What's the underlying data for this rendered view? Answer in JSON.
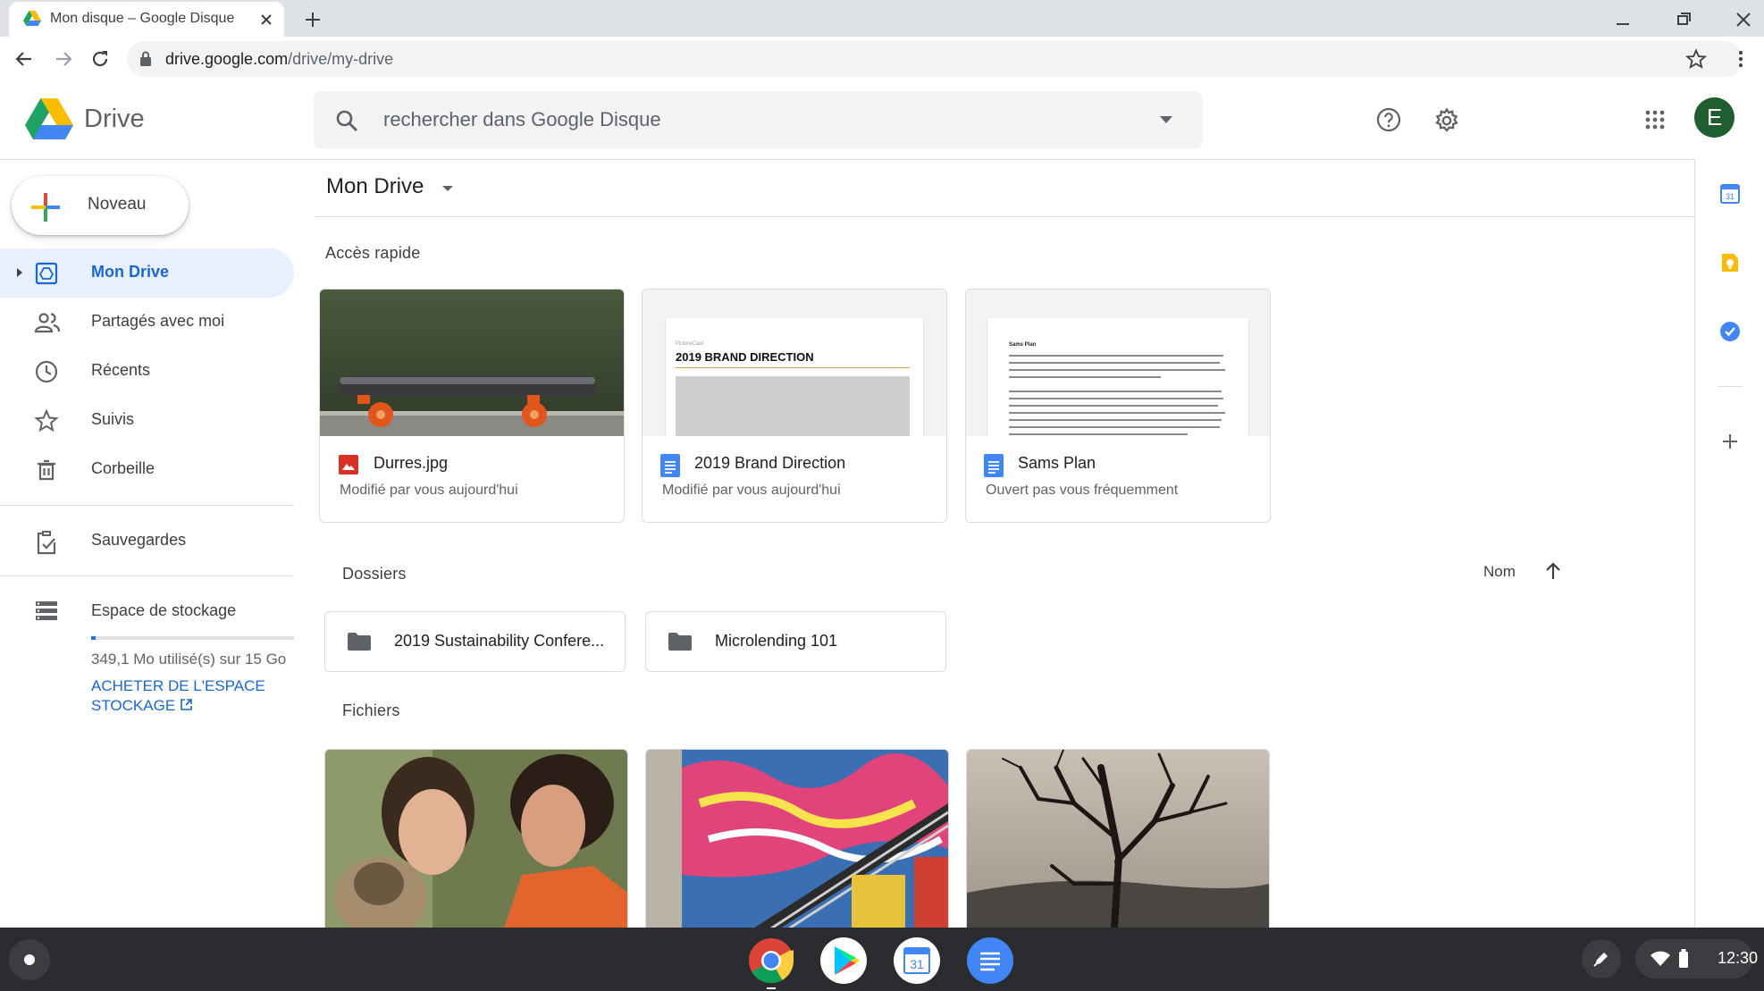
{
  "browser": {
    "tab_title": "Mon disque – Google Disque",
    "url_host": "drive.google.com",
    "url_path": "/drive/my-drive"
  },
  "header": {
    "product": "Drive",
    "search_placeholder": "rechercher dans Google Disque",
    "avatar_letter": "E"
  },
  "sidebar": {
    "new_label": "Noveau",
    "items": [
      {
        "label": "Mon Drive",
        "icon": "my-drive-icon",
        "active": true
      },
      {
        "label": "Partagés avec moi",
        "icon": "people-icon"
      },
      {
        "label": "Récents",
        "icon": "clock-icon"
      },
      {
        "label": "Suivis",
        "icon": "star-icon"
      },
      {
        "label": "Corbeille",
        "icon": "trash-icon"
      },
      {
        "label": "Sauvegardes",
        "icon": "backup-icon"
      },
      {
        "label": "Espace de stockage",
        "icon": "storage-icon"
      }
    ],
    "storage_text": "349,1 Mo utilisé(s) sur 15 Go",
    "storage_used_fraction": 0.023,
    "buy_storage": "ACHETER DE L'ESPACE STOCKAGE"
  },
  "main": {
    "breadcrumb": "Mon Drive",
    "quick_access_title": "Accès rapide",
    "quick_access": [
      {
        "name": "Durres.jpg",
        "subtitle": "Modifié par vous aujourd'hui",
        "type": "image"
      },
      {
        "name": "2019 Brand Direction",
        "subtitle": "Modifié par vous aujourd'hui",
        "type": "doc",
        "thumb_label": "PictureCast",
        "thumb_title": "2019 BRAND DIRECTION"
      },
      {
        "name": "Sams Plan",
        "subtitle": "Ouvert pas vous fréquemment",
        "type": "doc",
        "thumb_title": "Sams Plan"
      }
    ],
    "folders_title": "Dossiers",
    "sort_label": "Nom",
    "folders": [
      "2019 Sustainability Confere...",
      "Microlending 101"
    ],
    "files_title": "Fichiers"
  },
  "shelf": {
    "time": "12:30",
    "calendar_day": "31"
  },
  "colors": {
    "accent": "#1a73e8",
    "active_nav_bg": "#e8f0fe",
    "avatar": "#1e5e2f"
  }
}
